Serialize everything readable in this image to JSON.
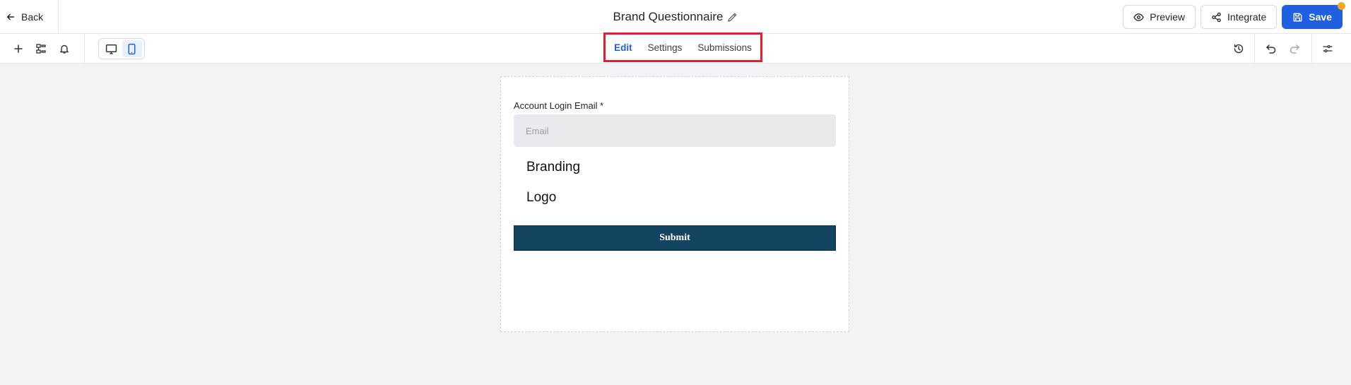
{
  "header": {
    "back_label": "Back",
    "title": "Brand Questionnaire",
    "actions": {
      "preview_label": "Preview",
      "integrate_label": "Integrate",
      "save_label": "Save"
    },
    "colors": {
      "save": "#1f5fe0",
      "save_indicator": "#f5a623"
    }
  },
  "toolbar": {
    "left_icons": [
      "plus-icon",
      "layers-icon",
      "bell-icon"
    ],
    "device_toggle": [
      "desktop-icon",
      "mobile-icon"
    ],
    "active_device": "mobile",
    "tabs": [
      {
        "label": "Edit",
        "active": true
      },
      {
        "label": "Settings",
        "active": false
      },
      {
        "label": "Submissions",
        "active": false
      }
    ],
    "right_icons": [
      "history-icon",
      "undo-icon",
      "redo-icon",
      "sliders-icon"
    ],
    "highlight_color": "#e21f2c"
  },
  "form": {
    "email_label": "Account Login Email *",
    "email_placeholder": "Email",
    "email_value": "",
    "heading_branding": "Branding",
    "heading_logo": "Logo",
    "submit_label": "Submit",
    "colors": {
      "submit_bg": "#134561",
      "input_bg": "#e8eaed"
    }
  }
}
